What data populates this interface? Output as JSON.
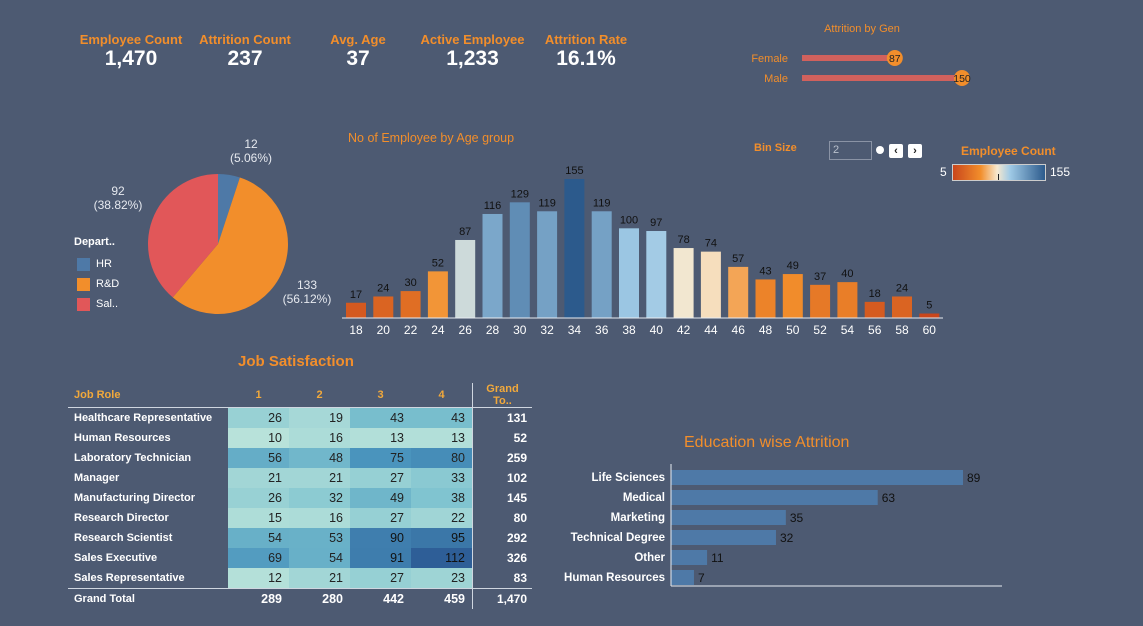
{
  "kpis": [
    {
      "label": "Employee Count",
      "value": "1,470"
    },
    {
      "label": "Attrition Count",
      "value": "237"
    },
    {
      "label": "Avg. Age",
      "value": "37"
    },
    {
      "label": "Active Employee",
      "value": "1,233"
    },
    {
      "label": "Attrition Rate",
      "value": "16.1%"
    }
  ],
  "colors": {
    "background": "#4d5a72",
    "accent": "#f28e2b",
    "gender_bar": "#d1615d",
    "marker": "#f28e2b"
  },
  "bin_control": {
    "label": "Bin Size",
    "value": "2",
    "prev_icon": "chevron-left-icon",
    "next_icon": "chevron-right-icon"
  },
  "color_legend": {
    "title": "Employee Count",
    "min": "5",
    "max": "155"
  },
  "chart_data": [
    {
      "type": "bar",
      "title": "Attrition by Gen",
      "orientation": "horizontal",
      "categories": [
        "Female",
        "Male"
      ],
      "values": [
        87,
        150
      ],
      "xlim": [
        0,
        150
      ]
    },
    {
      "type": "pie",
      "legend_title": "Depart..",
      "legend_placement": "left",
      "labels": [
        "HR",
        "R&D",
        "Sal.."
      ],
      "values": [
        12,
        133,
        92
      ],
      "value_labels": [
        "12",
        "133",
        "92"
      ],
      "percent_labels": [
        "(5.06%)",
        "(56.12%)",
        "(38.82%)"
      ],
      "colors": [
        "#4e79a7",
        "#f28e2b",
        "#e15759"
      ]
    },
    {
      "type": "bar",
      "title": "No of Employee by Age group",
      "categories": [
        "18",
        "20",
        "22",
        "24",
        "26",
        "28",
        "30",
        "32",
        "34",
        "36",
        "38",
        "40",
        "42",
        "44",
        "46",
        "48",
        "50",
        "52",
        "54",
        "56",
        "58",
        "60"
      ],
      "values": [
        17,
        24,
        30,
        52,
        87,
        116,
        129,
        119,
        155,
        119,
        100,
        97,
        78,
        74,
        57,
        43,
        49,
        37,
        40,
        18,
        24,
        5
      ],
      "ylim": [
        0,
        155
      ],
      "color_scale": {
        "type": "diverging",
        "min": 5,
        "max": 155,
        "low_color": "#c9461c",
        "mid_color": "#f0e6d2",
        "high_color": "#2c5a8c"
      }
    },
    {
      "type": "heatmap",
      "title": "Job Satisfaction",
      "row_header": "Job Role",
      "columns": [
        "1",
        "2",
        "3",
        "4"
      ],
      "total_header": "Grand To..",
      "total_row_label": "Grand Total",
      "rows": [
        {
          "role": "Healthcare Representative",
          "values": [
            26,
            19,
            43,
            43
          ],
          "total": "131"
        },
        {
          "role": "Human Resources",
          "values": [
            10,
            16,
            13,
            13
          ],
          "total": "52"
        },
        {
          "role": "Laboratory Technician",
          "values": [
            56,
            48,
            75,
            80
          ],
          "total": "259"
        },
        {
          "role": "Manager",
          "values": [
            21,
            21,
            27,
            33
          ],
          "total": "102"
        },
        {
          "role": "Manufacturing Director",
          "values": [
            26,
            32,
            49,
            38
          ],
          "total": "145"
        },
        {
          "role": "Research Director",
          "values": [
            15,
            16,
            27,
            22
          ],
          "total": "80"
        },
        {
          "role": "Research Scientist",
          "values": [
            54,
            53,
            90,
            95
          ],
          "total": "292"
        },
        {
          "role": "Sales Executive",
          "values": [
            69,
            54,
            91,
            112
          ],
          "total": "326"
        },
        {
          "role": "Sales Representative",
          "values": [
            12,
            21,
            27,
            23
          ],
          "total": "83"
        }
      ],
      "column_totals": [
        "289",
        "280",
        "442",
        "459"
      ],
      "grand_total": "1,470"
    },
    {
      "type": "bar",
      "title": "Education wise Attrition",
      "orientation": "horizontal",
      "categories": [
        "Life Sciences",
        "Medical",
        "Marketing",
        "Technical Degree",
        "Other",
        "Human Resources"
      ],
      "values": [
        89,
        63,
        35,
        32,
        11,
        7
      ],
      "xlim": [
        0,
        89
      ],
      "color": "#4e79a7"
    }
  ]
}
